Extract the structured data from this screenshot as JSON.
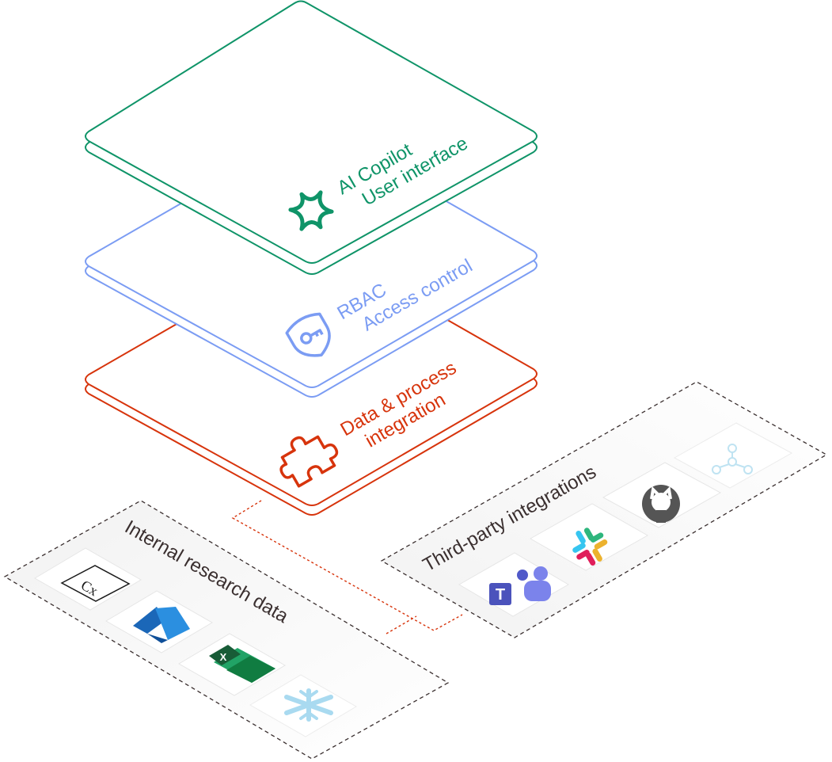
{
  "layers": [
    {
      "id": "ai",
      "line1": "AI Copilot",
      "line2": "User interface",
      "color": "#0f9468",
      "icon": "sparkle-star-icon"
    },
    {
      "id": "rbac",
      "line1": "RBAC",
      "line2": "Access control",
      "color": "#7b9cf3",
      "icon": "shield-key-icon"
    },
    {
      "id": "data",
      "line1": "Data & process",
      "line2": "integration",
      "color": "#d7340c",
      "icon": "puzzle-piece-icon"
    }
  ],
  "groups": {
    "internal": {
      "label": "Internal research data",
      "items": [
        {
          "name": "cx-logo",
          "text": "Cx"
        },
        {
          "name": "azure-logo"
        },
        {
          "name": "excel-logo",
          "text": "X"
        },
        {
          "name": "snowflake-logo"
        }
      ]
    },
    "third_party": {
      "label": "Third-party integrations",
      "items": [
        {
          "name": "teams-logo",
          "text": "T"
        },
        {
          "name": "slack-logo"
        },
        {
          "name": "github-logo"
        },
        {
          "name": "network-nodes-logo"
        }
      ]
    }
  },
  "colors": {
    "connector": "#d7340c",
    "dashed_border": "#3a2f2f",
    "tile_border": "#e6e6e6"
  }
}
